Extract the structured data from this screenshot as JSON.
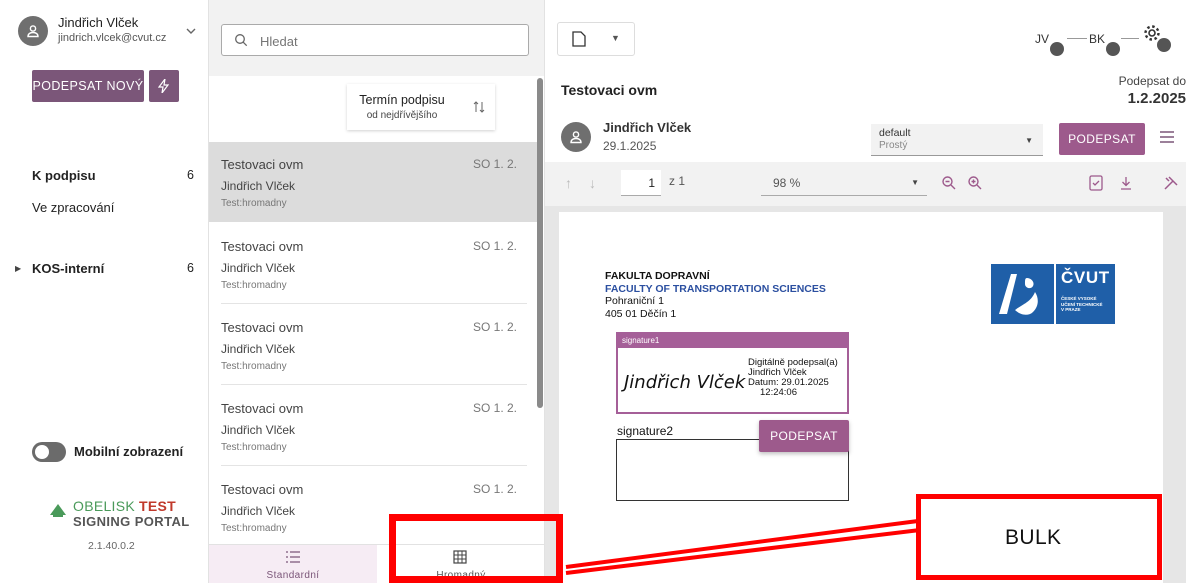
{
  "user": {
    "name": "Jindřich Vlček",
    "email": "jindrich.vlcek@cvut.cz"
  },
  "sidebar": {
    "new_button": "PODEPSAT NOVÝ",
    "items": [
      {
        "label": "K podpisu",
        "count": "6"
      },
      {
        "label": "Ve zpracování",
        "count": ""
      },
      {
        "label": "KOS-interní",
        "count": "6"
      }
    ],
    "mobile_toggle": "Mobilní zobrazení",
    "logo": {
      "line1": "OBELISK",
      "test": "TEST",
      "line2": "SIGNING PORTAL",
      "version": "2.1.40.0.2"
    }
  },
  "list": {
    "search_placeholder": "Hledat",
    "sort": {
      "title": "Termín podpisu",
      "subtitle": "od nejdřívějšího"
    },
    "items": [
      {
        "title": "Testovaci ovm",
        "name": "Jindřich Vlček",
        "sub": "Test:hromadny",
        "date": "SO 1. 2."
      },
      {
        "title": "Testovaci ovm",
        "name": "Jindřich Vlček",
        "sub": "Test:hromadny",
        "date": "SO 1. 2."
      },
      {
        "title": "Testovaci ovm",
        "name": "Jindřich Vlček",
        "sub": "Test:hromadny",
        "date": "SO 1. 2."
      },
      {
        "title": "Testovaci ovm",
        "name": "Jindřich Vlček",
        "sub": "Test:hromadny",
        "date": "SO 1. 2."
      },
      {
        "title": "Testovaci ovm",
        "name": "Jindřich Vlček",
        "sub": "Test:hromadny",
        "date": "SO 1. 2."
      }
    ],
    "tabs": [
      {
        "label": "Standardní"
      },
      {
        "label": "Hromadný"
      }
    ]
  },
  "detail": {
    "participants": [
      "JV",
      "BK"
    ],
    "title": "Testovaci ovm",
    "due_label": "Podepsat do",
    "due_date": "1.2.2025",
    "signer": {
      "name": "Jindřich Vlček",
      "date": "29.1.2025"
    },
    "profile": {
      "value": "default",
      "sub": "Prostý"
    },
    "sign_button": "PODEPSAT",
    "toolbar": {
      "page": "1",
      "page_of": "z 1",
      "zoom": "98 %"
    },
    "doc": {
      "line1": "FAKULTA DOPRAVNÍ",
      "line2": "FACULTY OF TRANSPORTATION SCIENCES",
      "line3": "Pohraniční 1",
      "line4": "405 01 Děčín 1",
      "logo_text": "ČVUT",
      "logo_small": [
        "ČESKÉ VYSOKÉ",
        "UČENÍ TECHNICKÉ",
        "V PRAZE"
      ],
      "sig1_label": "signature1",
      "sig1_name": "Jindřich Vlček",
      "sig1_info": [
        "Digitálně podepsal(a)",
        "Jindřich Vlček",
        "Datum: 29.01.2025",
        "12:24:06"
      ],
      "sig2_label": "signature2",
      "sig2_button": "PODEPSAT"
    }
  },
  "annotation": {
    "label": "BULK",
    "color": "#ff0000"
  }
}
